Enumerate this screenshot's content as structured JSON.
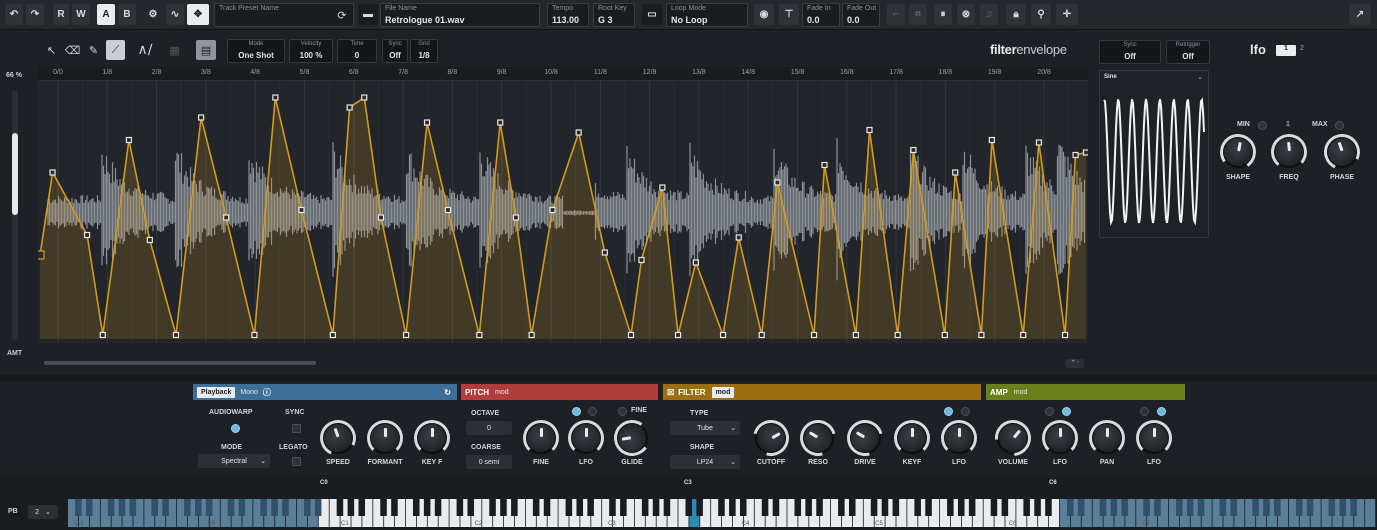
{
  "toolbar": {
    "track_preset": {
      "label": "Track Preset Name",
      "value": ""
    },
    "file_name": {
      "label": "File Name",
      "value": "Retrologue 01.wav"
    },
    "tempo": {
      "label": "Tempo",
      "value": "113.00"
    },
    "root_key": {
      "label": "Root Key",
      "value": "G 3"
    },
    "loop_mode": {
      "label": "Loop Mode",
      "value": "No Loop"
    },
    "fade_in": {
      "label": "Fade In",
      "value": "0.0"
    },
    "fade_out": {
      "label": "Fade Out",
      "value": "0.0"
    },
    "rec_r": "R",
    "rec_w": "W",
    "btn_a": "A",
    "btn_b": "B"
  },
  "editor": {
    "mode": {
      "label": "Mode",
      "value": "One Shot"
    },
    "velocity": {
      "label": "Velocity",
      "value": "100 %"
    },
    "time": {
      "label": "Time",
      "value": "0"
    },
    "sync": {
      "label": "Sync",
      "value": "Off"
    },
    "grid": {
      "label": "Grid",
      "value": "1/8"
    },
    "percent": "66 %",
    "amt": "AMT",
    "brand_bold": "filter",
    "brand_light": "envelope",
    "ruler_ticks": [
      "0/0",
      "1/8",
      "2/8",
      "3/8",
      "4/8",
      "5/8",
      "6/8",
      "7/8",
      "8/8",
      "9/8",
      "10/8",
      "11/8",
      "12/8",
      "13/8",
      "14/8",
      "15/8",
      "16/8",
      "17/8",
      "18/8",
      "19/8",
      "20/8"
    ],
    "zoom": "+ -"
  },
  "lfo": {
    "title": "lfo",
    "index": "1",
    "index2": "2",
    "sync": {
      "label": "Sync",
      "value": "Off"
    },
    "retrigger": {
      "label": "Retrigger",
      "value": "Off"
    },
    "waveform": "Sine",
    "options": [
      "MIN",
      "1",
      "MAX"
    ],
    "knobs": [
      "SHAPE",
      "FREQ",
      "PHASE"
    ]
  },
  "playback": {
    "tag": "Playback",
    "name": "Mono",
    "audiowarp": "AUDIOWARP",
    "sync": "SYNC",
    "mode_label": "MODE",
    "mode_value": "Spectral",
    "legato": "LEGATO",
    "knobs": [
      "SPEED",
      "FORMANT",
      "KEY F"
    ]
  },
  "pitch": {
    "tag": "PITCH",
    "name": "mod",
    "octave_label": "OCTAVE",
    "octave_value": "0",
    "coarse_label": "COARSE",
    "coarse_value": "0 semi",
    "fine_label": "FINE",
    "knobs": [
      "FINE",
      "LFO",
      "GLIDE"
    ]
  },
  "filter": {
    "tag": "FILTER",
    "name": "mod",
    "type_label": "TYPE",
    "type_value": "Tube",
    "shape_label": "SHAPE",
    "shape_value": "LP24",
    "knobs": [
      "CUTOFF",
      "RESO",
      "DRIVE",
      "KEYF",
      "LFO"
    ]
  },
  "amp": {
    "tag": "AMP",
    "name": "mod",
    "knobs": [
      "VOLUME",
      "LFO",
      "PAN",
      "LFO"
    ]
  },
  "keyboard": {
    "pb_label": "PB",
    "pb_value": "2",
    "markers": [
      "C0",
      "C3",
      "C6"
    ],
    "octaves": [
      "C-1",
      "C0",
      "C1",
      "C2",
      "C3",
      "C4",
      "C5",
      "C6",
      "C7"
    ]
  },
  "colors": {
    "playback": "#3e6f96",
    "pitch": "#b23b3b",
    "filter": "#9c6e12",
    "amp": "#6b7f1a",
    "envelope": "#d39a22",
    "waveform": "#9ea3a9",
    "key_highlight": "#2c8ab8"
  },
  "envelope_points": [
    [
      0.0,
      0.68
    ],
    [
      0.012,
      0.35
    ],
    [
      0.045,
      0.6
    ],
    [
      0.06,
      1.0
    ],
    [
      0.085,
      0.22
    ],
    [
      0.105,
      0.62
    ],
    [
      0.13,
      1.0
    ],
    [
      0.154,
      0.13
    ],
    [
      0.178,
      0.53
    ],
    [
      0.205,
      1.0
    ],
    [
      0.225,
      0.05
    ],
    [
      0.25,
      0.5
    ],
    [
      0.28,
      1.0
    ],
    [
      0.296,
      0.09
    ],
    [
      0.31,
      0.05
    ],
    [
      0.326,
      0.53
    ],
    [
      0.35,
      1.0
    ],
    [
      0.37,
      0.15
    ],
    [
      0.39,
      0.5
    ],
    [
      0.42,
      1.0
    ],
    [
      0.44,
      0.15
    ],
    [
      0.455,
      0.53
    ],
    [
      0.47,
      1.0
    ],
    [
      0.49,
      0.5
    ],
    [
      0.515,
      0.19
    ],
    [
      0.54,
      0.67
    ],
    [
      0.565,
      1.0
    ],
    [
      0.575,
      0.7
    ],
    [
      0.595,
      0.41
    ],
    [
      0.61,
      1.0
    ],
    [
      0.627,
      0.71
    ],
    [
      0.653,
      1.0
    ],
    [
      0.668,
      0.61
    ],
    [
      0.69,
      1.0
    ],
    [
      0.705,
      0.39
    ],
    [
      0.74,
      1.0
    ],
    [
      0.75,
      0.32
    ],
    [
      0.78,
      1.0
    ],
    [
      0.793,
      0.18
    ],
    [
      0.82,
      1.0
    ],
    [
      0.835,
      0.26
    ],
    [
      0.865,
      1.0
    ],
    [
      0.875,
      0.35
    ],
    [
      0.9,
      1.0
    ],
    [
      0.91,
      0.22
    ],
    [
      0.94,
      1.0
    ],
    [
      0.955,
      0.23
    ],
    [
      0.98,
      1.0
    ],
    [
      0.99,
      0.28
    ],
    [
      1.0,
      0.27
    ]
  ]
}
